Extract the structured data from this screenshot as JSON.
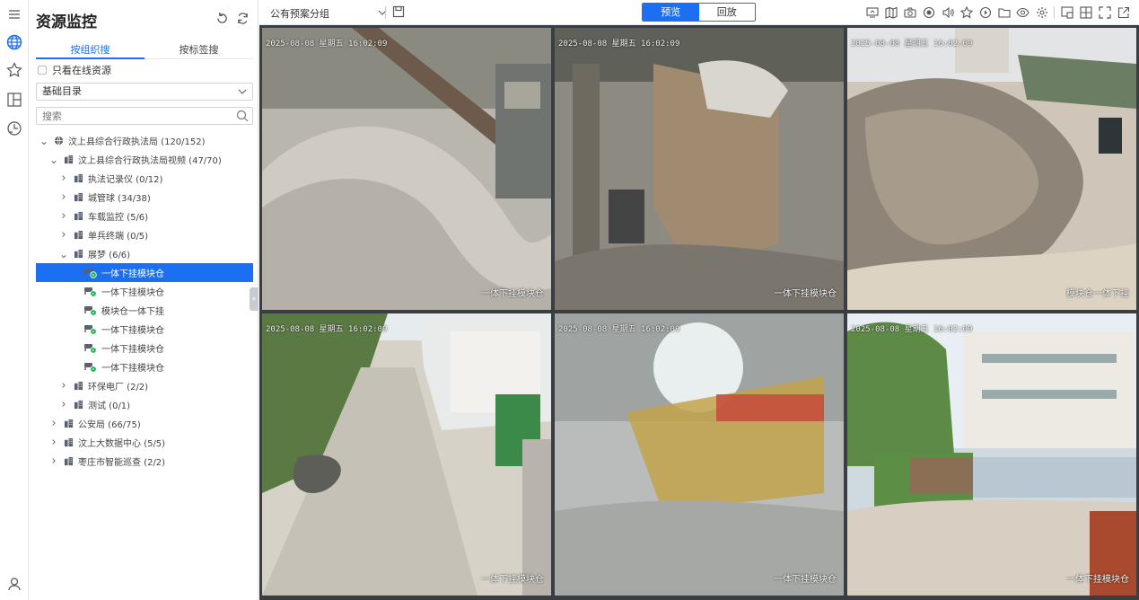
{
  "panel": {
    "title": "资源监控",
    "tabs": [
      "按组织搜",
      "按标签搜"
    ],
    "online_only_label": "只看在线资源",
    "directory_select": "基础目录",
    "search_placeholder": "搜索"
  },
  "tree": [
    {
      "label": "汶上县综合行政执法局 (120/152)",
      "depth": 0,
      "caret": "down",
      "icon": "globe-icon",
      "selected": false
    },
    {
      "label": "汶上县综合行政执法局视频 (47/70)",
      "depth": 1,
      "caret": "down",
      "icon": "building-icon",
      "selected": false
    },
    {
      "label": "执法记录仪 (0/12)",
      "depth": 2,
      "caret": "right",
      "icon": "building-icon",
      "selected": false
    },
    {
      "label": "城管球 (34/38)",
      "depth": 2,
      "caret": "right",
      "icon": "building-icon",
      "selected": false
    },
    {
      "label": "车载监控 (5/6)",
      "depth": 2,
      "caret": "right",
      "icon": "building-icon",
      "selected": false
    },
    {
      "label": "单兵终端 (0/5)",
      "depth": 2,
      "caret": "right",
      "icon": "building-icon",
      "selected": false
    },
    {
      "label": "展梦 (6/6)",
      "depth": 2,
      "caret": "down",
      "icon": "building-icon",
      "selected": false
    },
    {
      "label": "一体下挂模块仓",
      "depth": 3,
      "caret": "",
      "icon": "camera-online-icon",
      "selected": true
    },
    {
      "label": "一体下挂模块仓",
      "depth": 3,
      "caret": "",
      "icon": "camera-online-icon",
      "selected": false
    },
    {
      "label": "模块仓一体下挂",
      "depth": 3,
      "caret": "",
      "icon": "camera-online-icon",
      "selected": false
    },
    {
      "label": "一体下挂模块仓",
      "depth": 3,
      "caret": "",
      "icon": "camera-online-icon",
      "selected": false
    },
    {
      "label": "一体下挂模块仓",
      "depth": 3,
      "caret": "",
      "icon": "camera-online-icon",
      "selected": false
    },
    {
      "label": "一体下挂模块仓",
      "depth": 3,
      "caret": "",
      "icon": "camera-online-icon",
      "selected": false
    },
    {
      "label": "环保电厂 (2/2)",
      "depth": 2,
      "caret": "right",
      "icon": "building-icon",
      "selected": false
    },
    {
      "label": "测试 (0/1)",
      "depth": 2,
      "caret": "right",
      "icon": "building-icon",
      "selected": false
    },
    {
      "label": "公安局 (66/75)",
      "depth": 1,
      "caret": "right",
      "icon": "building-icon",
      "selected": false
    },
    {
      "label": "汶上大数据中心 (5/5)",
      "depth": 1,
      "caret": "right",
      "icon": "building-icon",
      "selected": false
    },
    {
      "label": "枣庄市智能巡查 (2/2)",
      "depth": 1,
      "caret": "right",
      "icon": "building-icon",
      "selected": false
    }
  ],
  "toolbar": {
    "group_select": "公有预案分组",
    "mode_preview": "预览",
    "mode_playback": "回放"
  },
  "videos": [
    {
      "timestamp": "2025-08-08 星期五 16:02:09",
      "caption": "一体下挂模块仓",
      "scene": "gravel-pile"
    },
    {
      "timestamp": "2025-08-08 星期五 16:02:09",
      "caption": "一体下挂模块仓",
      "scene": "crusher"
    },
    {
      "timestamp": "2025-08-08 星期五 16:02:09",
      "caption": "模块仓一体下挂",
      "scene": "rubble-yard"
    },
    {
      "timestamp": "2025-08-08 星期五 16:02:09",
      "caption": "一体下挂模块仓",
      "scene": "road"
    },
    {
      "timestamp": "2025-08-08 星期五 16:02:09",
      "caption": "一体下挂模块仓",
      "scene": "dusty-workshop"
    },
    {
      "timestamp": "2025-08-08 星期五 16:02:09",
      "caption": "一体下挂模块仓",
      "scene": "truck-yard"
    }
  ],
  "colors": {
    "accent": "#1d6ff2",
    "online": "#19b34a",
    "grid_bg": "#3a3d42"
  }
}
